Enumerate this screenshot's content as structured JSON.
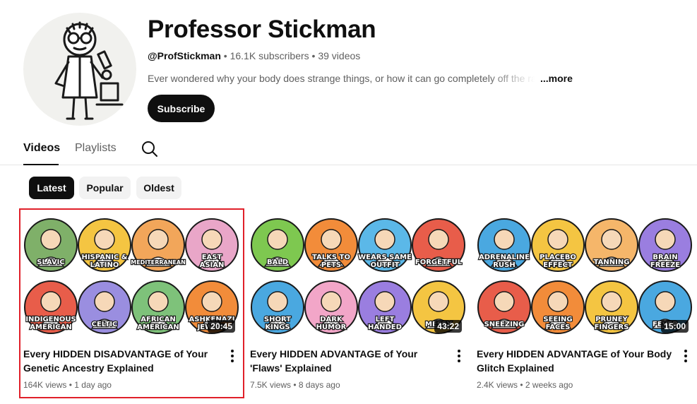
{
  "channel": {
    "name": "Professor Stickman",
    "handle": "@ProfStickman",
    "subscribers": "16.1K subscribers",
    "videos_count": "39 videos",
    "description": "Ever wondered why your body does strange things, or how it can go completely off the rai",
    "more_label": "...more",
    "subscribe_label": "Subscribe"
  },
  "tabs": [
    {
      "label": "Videos",
      "active": true
    },
    {
      "label": "Playlists",
      "active": false
    }
  ],
  "chips": [
    {
      "label": "Latest",
      "active": true
    },
    {
      "label": "Popular",
      "active": false
    },
    {
      "label": "Oldest",
      "active": false
    }
  ],
  "videos": [
    {
      "title": "Every HIDDEN DISADVANTAGE of Your Genetic Ancestry Explained",
      "views": "164K views",
      "age": "1 day ago",
      "duration": "20:45",
      "thumb_labels": [
        "SLAVIC",
        "HISPANIC & LATINO",
        "MEDITERRANEAN",
        "EAST ASIAN",
        "INDIGENOUS AMERICAN",
        "CELTIC",
        "AFRICAN AMERICAN",
        "ASHKENAZI JEWISH"
      ],
      "thumb_colors": [
        "#7fb069",
        "#f4c542",
        "#f2a65a",
        "#e9a6c8",
        "#e85d4a",
        "#9a8ee0",
        "#7ec27a",
        "#f28c3a"
      ],
      "selected": true
    },
    {
      "title": "Every HIDDEN ADVANTAGE of Your 'Flaws' Explained",
      "views": "7.5K views",
      "age": "8 days ago",
      "duration": "43:22",
      "thumb_labels": [
        "BALD",
        "TALKS TO PETS",
        "WEARS SAME OUTFIT",
        "FORGETFUL",
        "SHORT KINGS",
        "DARK HUMOR",
        "LEFT HANDED",
        "MESSY"
      ],
      "thumb_colors": [
        "#7ec850",
        "#f28c3a",
        "#5bb8e8",
        "#e85d4a",
        "#4aa8e0",
        "#f2a6c8",
        "#9a7ee0",
        "#f4c542"
      ],
      "selected": false
    },
    {
      "title": "Every HIDDEN ADVANTAGE of Your Body Glitch Explained",
      "views": "2.4K views",
      "age": "2 weeks ago",
      "duration": "15:00",
      "thumb_labels": [
        "ADRENALINE RUSH",
        "PLACEBO EFFECT",
        "TANNING",
        "BRAIN FREEZE",
        "SNEEZING",
        "SEEING FACES",
        "PRUNEY FINGERS",
        "FEVER"
      ],
      "thumb_colors": [
        "#4aa8e0",
        "#f4c542",
        "#f5b66a",
        "#9a7ee0",
        "#e85d4a",
        "#f28c3a",
        "#f4c542",
        "#4aa8e0"
      ],
      "selected": false
    }
  ],
  "colors": {
    "text_primary": "#0f0f0f",
    "text_secondary": "#606060",
    "highlight": "#e0202a"
  }
}
